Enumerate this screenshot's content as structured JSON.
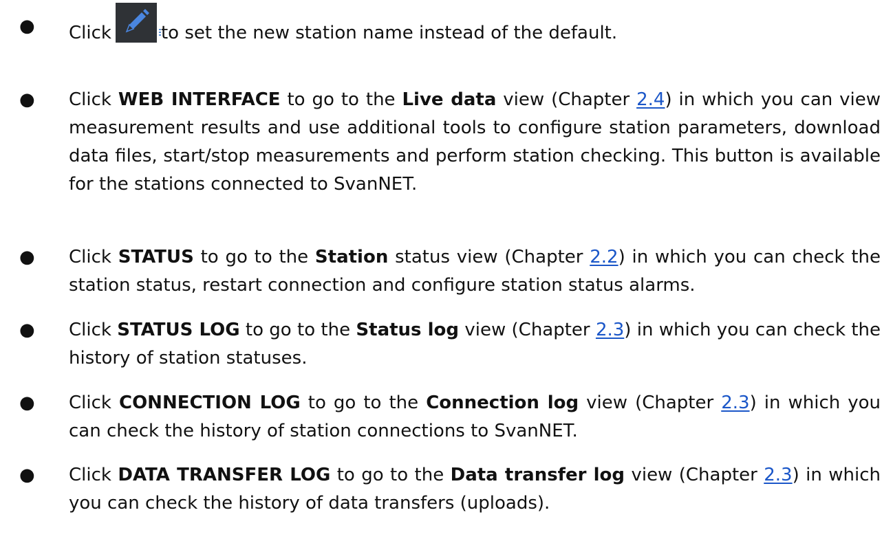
{
  "items": [
    {
      "t1": "Click",
      "icon": "pencil-icon",
      "t2": "to set the new station name instead of the default."
    },
    {
      "t1": "Click ",
      "b1": "WEB INTERFACE",
      "t2": " to go to the ",
      "b2": "Live data",
      "t3": " view (Chapter ",
      "ref": "2.4",
      "t4": ") in which you can view measurement results and use additional tools to configure station parameters, download data files, start/stop measurements and perform station checking. This button is available for the stations connected to SvanNET."
    },
    {
      "t1": "Click ",
      "b1": "STATUS",
      "t2": " to go to the ",
      "b2": "Station",
      "t3": " status view (Chapter ",
      "ref": "2.2",
      "t4": ") in which you can check the station status, restart connection and configure station status alarms."
    },
    {
      "t1": "Click ",
      "b1": "STATUS LOG",
      "t2": " to go to the ",
      "b2": "Status log",
      "t3": " view (Chapter ",
      "ref": "2.3",
      "t4": ") in which you can check the history of station statuses."
    },
    {
      "t1": "Click ",
      "b1": "CONNECTION LOG",
      "t2": " to go to the ",
      "b2": "Connection log",
      "t3": " view (Chapter ",
      "ref": "2.3",
      "t4": ") in which you can check the history of station connections to SvanNET."
    },
    {
      "t1": "Click ",
      "b1": "DATA TRANSFER LOG",
      "t2": " to go to the ",
      "b2": "Data transfer log",
      "t3": " view (Chapter ",
      "ref": "2.3",
      "t4": ") in which you can check the history of data transfers (uploads)."
    }
  ],
  "colors": {
    "text": "#111111",
    "link": "#1a56c8",
    "icon_bg": "#2f3236",
    "icon_fg": "#4a86e0"
  }
}
